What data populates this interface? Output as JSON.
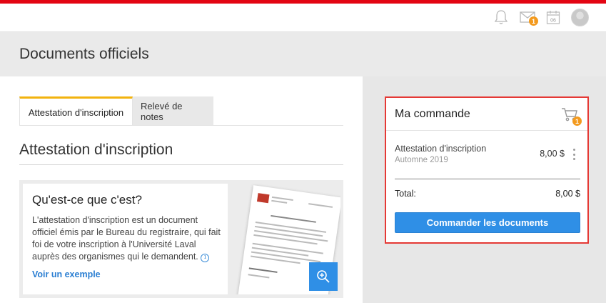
{
  "header": {
    "icons": [
      "bell-icon",
      "mail-icon",
      "calendar-icon",
      "avatar"
    ],
    "mail_badge": "1",
    "calendar_day": "06",
    "accent_color": "#e30513"
  },
  "page": {
    "title": "Documents officiels"
  },
  "tabs": [
    {
      "label": "Attestation d'inscription",
      "active": true
    },
    {
      "label": "Relevé de notes",
      "active": false
    }
  ],
  "section": {
    "title": "Attestation d'inscription"
  },
  "info": {
    "title": "Qu'est-ce que c'est?",
    "text": "L'attestation d'inscription est un document officiel émis par le Bureau du registraire, qui fait foi de votre inscription à l'Université Laval auprès des organismes qui le demandent.",
    "info_glyph": "i",
    "link": "Voir un exemple"
  },
  "order": {
    "title": "Ma commande",
    "cart_badge": "1",
    "item": {
      "name": "Attestation d'inscription",
      "term": "Automne 2019",
      "price": "8,00 $"
    },
    "total_label": "Total:",
    "total_value": "8,00 $",
    "button": "Commander les documents",
    "highlight_color": "#e53935",
    "button_color": "#2f8fe6"
  }
}
